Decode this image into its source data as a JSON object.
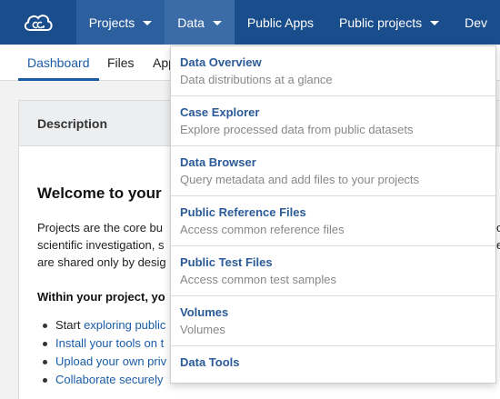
{
  "nav": {
    "items": [
      {
        "label": "Projects"
      },
      {
        "label": "Data"
      },
      {
        "label": "Public Apps"
      },
      {
        "label": "Public projects"
      },
      {
        "label": "Dev"
      }
    ]
  },
  "subtabs": [
    "Dashboard",
    "Files",
    "App"
  ],
  "card": {
    "header": "Description",
    "welcome": "Welcome to your",
    "para": [
      "Projects are the core bu",
      "scientific investigation, s",
      "are shared only by desig"
    ],
    "within": "Within your project, yo",
    "bullets": [
      {
        "prefix": "Start ",
        "link": "exploring public"
      },
      {
        "prefix": "",
        "link": "Install your tools on t"
      },
      {
        "prefix": "",
        "link": "Upload your own priv"
      },
      {
        "prefix": "",
        "link": "Collaborate securely"
      }
    ],
    "right_edge": [
      "o",
      "e"
    ]
  },
  "dropdown": {
    "items": [
      {
        "title": "Data Overview",
        "desc": "Data distributions at a glance"
      },
      {
        "title": "Case Explorer",
        "desc": "Explore processed data from public datasets"
      },
      {
        "title": "Data Browser",
        "desc": "Query metadata and add files to your projects"
      },
      {
        "title": "Public Reference Files",
        "desc": "Access common reference files"
      },
      {
        "title": "Public Test Files",
        "desc": "Access common test samples"
      },
      {
        "title": "Volumes",
        "desc": "Volumes"
      },
      {
        "title": "Data Tools",
        "desc": ""
      }
    ]
  },
  "colors": {
    "nav_bg": "#1a4d8c",
    "accent": "#1a5ca6",
    "dropdown_title": "#2a5a97"
  }
}
